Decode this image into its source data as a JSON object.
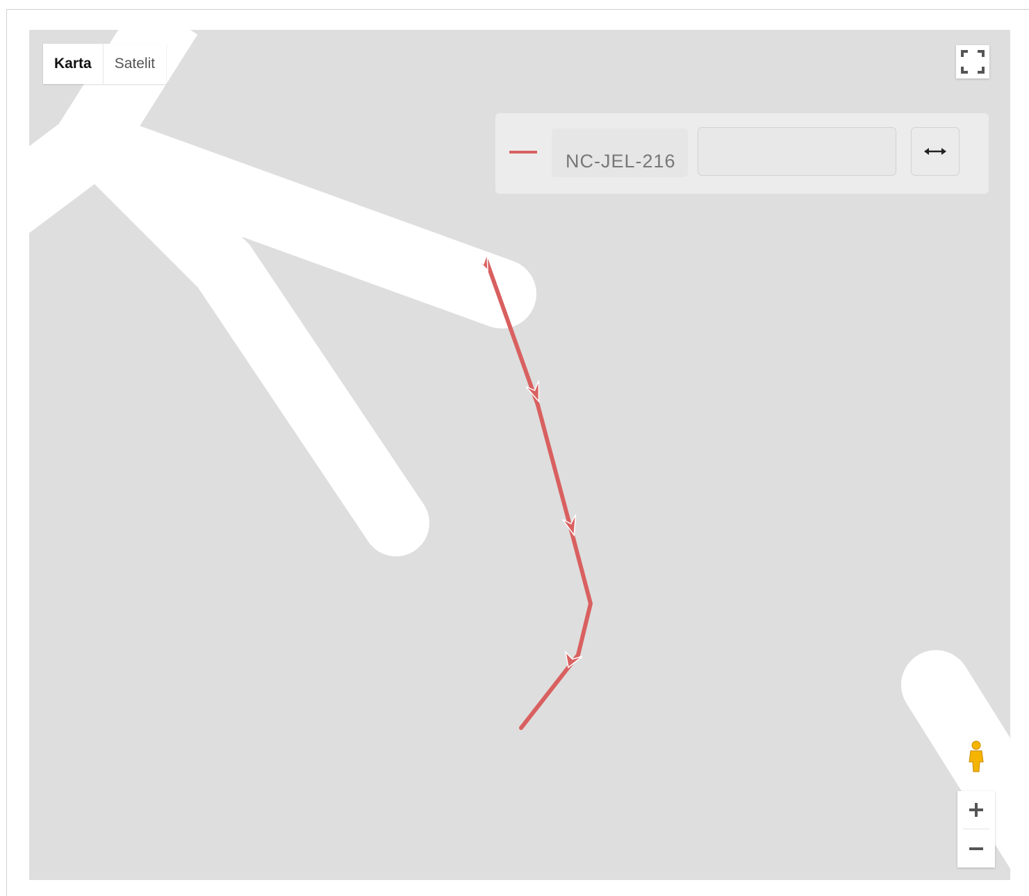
{
  "map_type": {
    "options": [
      "Karta",
      "Satelit"
    ],
    "selected": "Karta"
  },
  "legend": {
    "route_name": "NC-JEL-216",
    "route_color": "#d96060",
    "second_field_value": "",
    "swap_icon": "double-arrow-horizontal-icon"
  },
  "controls": {
    "fullscreen_icon": "fullscreen-icon",
    "street_view_icon": "pegman-icon",
    "zoom_in_label": "+",
    "zoom_out_label": "−"
  },
  "colors": {
    "map_background": "#dedede",
    "road": "#ffffff",
    "route": "#d96060"
  }
}
